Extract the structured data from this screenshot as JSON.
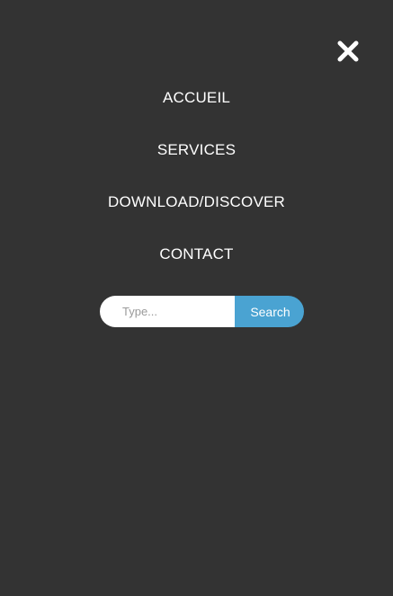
{
  "menu": {
    "close_icon": "close-icon",
    "items": [
      {
        "label": "ACCUEIL"
      },
      {
        "label": "SERVICES"
      },
      {
        "label": "DOWNLOAD/DISCOVER"
      },
      {
        "label": "CONTACT"
      }
    ]
  },
  "search": {
    "placeholder": "Type...",
    "value": "",
    "button_label": "Search"
  },
  "colors": {
    "background": "#333333",
    "text": "#ffffff",
    "accent": "#4aa3d2"
  }
}
